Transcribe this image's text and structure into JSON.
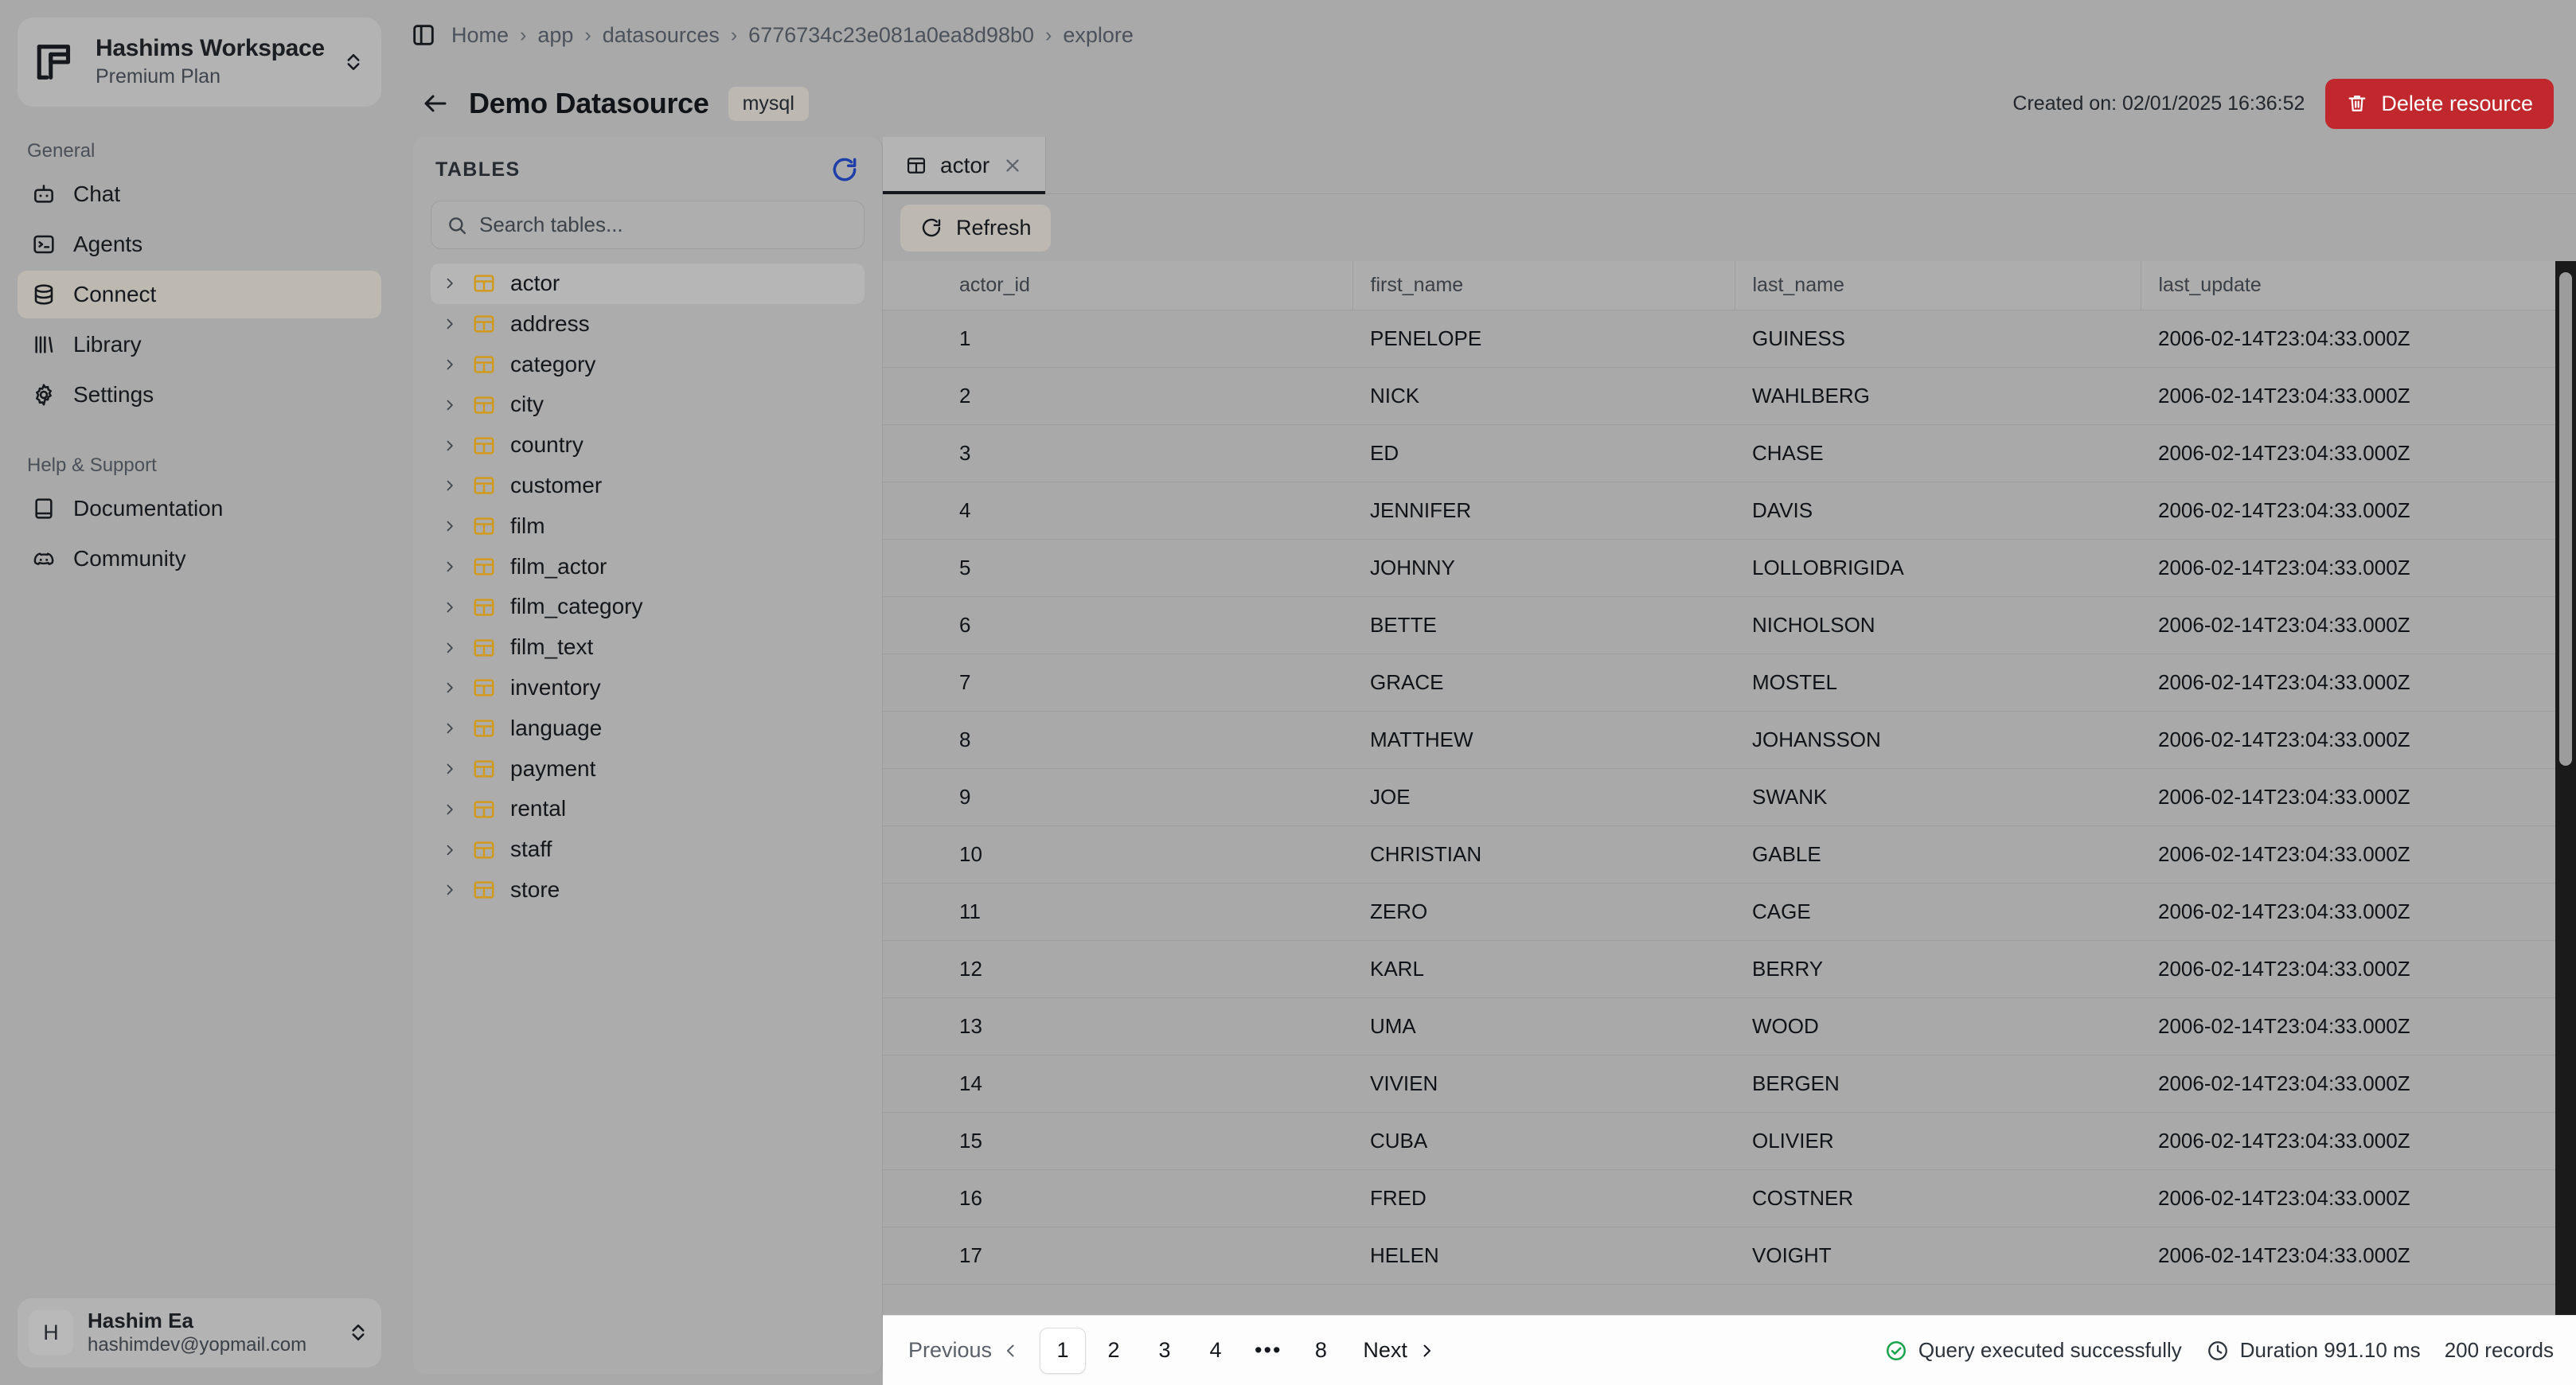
{
  "sidebar": {
    "workspace": {
      "name": "Hashims Workspace",
      "plan": "Premium Plan"
    },
    "sections": [
      {
        "title": "General",
        "items": [
          {
            "label": "Chat",
            "icon": "bot-icon"
          },
          {
            "label": "Agents",
            "icon": "terminal-icon"
          },
          {
            "label": "Connect",
            "icon": "database-icon",
            "active": true
          },
          {
            "label": "Library",
            "icon": "library-icon"
          },
          {
            "label": "Settings",
            "icon": "gear-icon"
          }
        ]
      },
      {
        "title": "Help & Support",
        "items": [
          {
            "label": "Documentation",
            "icon": "book-icon"
          },
          {
            "label": "Community",
            "icon": "discord-icon"
          }
        ]
      }
    ],
    "user": {
      "initial": "H",
      "name": "Hashim Ea",
      "email": "hashimdev@yopmail.com"
    }
  },
  "topbar": {
    "panel_toggle_icon": "panel-left-icon",
    "breadcrumbs": [
      "Home",
      "app",
      "datasources",
      "6776734c23e081a0ea8d98b0",
      "explore"
    ],
    "separator": "›"
  },
  "pagehead": {
    "back_icon": "arrow-left-icon",
    "title": "Demo Datasource",
    "engine": "mysql",
    "created_on": "Created on: 02/01/2025 16:36:52",
    "delete_label": "Delete resource",
    "delete_color": "#c0282d"
  },
  "tables_panel": {
    "title": "TABLES",
    "refresh_icon": "refresh-circle-icon",
    "refresh_color": "#1f3fa8",
    "search_placeholder": "Search tables...",
    "icon_color": "#d19a1d",
    "tables": [
      {
        "name": "actor",
        "selected": true
      },
      {
        "name": "address"
      },
      {
        "name": "category"
      },
      {
        "name": "city"
      },
      {
        "name": "country"
      },
      {
        "name": "customer"
      },
      {
        "name": "film"
      },
      {
        "name": "film_actor"
      },
      {
        "name": "film_category"
      },
      {
        "name": "film_text"
      },
      {
        "name": "inventory"
      },
      {
        "name": "language"
      },
      {
        "name": "payment"
      },
      {
        "name": "rental"
      },
      {
        "name": "staff"
      },
      {
        "name": "store"
      }
    ]
  },
  "tabs": [
    {
      "label": "actor",
      "icon": "table-icon",
      "active": true,
      "close_icon": "close-icon"
    }
  ],
  "toolbar": {
    "refresh_label": "Refresh",
    "refresh_icon": "refresh-icon"
  },
  "grid": {
    "columns": [
      "actor_id",
      "first_name",
      "last_name",
      "last_update"
    ],
    "rows": [
      [
        "1",
        "PENELOPE",
        "GUINESS",
        "2006-02-14T23:04:33.000Z"
      ],
      [
        "2",
        "NICK",
        "WAHLBERG",
        "2006-02-14T23:04:33.000Z"
      ],
      [
        "3",
        "ED",
        "CHASE",
        "2006-02-14T23:04:33.000Z"
      ],
      [
        "4",
        "JENNIFER",
        "DAVIS",
        "2006-02-14T23:04:33.000Z"
      ],
      [
        "5",
        "JOHNNY",
        "LOLLOBRIGIDA",
        "2006-02-14T23:04:33.000Z"
      ],
      [
        "6",
        "BETTE",
        "NICHOLSON",
        "2006-02-14T23:04:33.000Z"
      ],
      [
        "7",
        "GRACE",
        "MOSTEL",
        "2006-02-14T23:04:33.000Z"
      ],
      [
        "8",
        "MATTHEW",
        "JOHANSSON",
        "2006-02-14T23:04:33.000Z"
      ],
      [
        "9",
        "JOE",
        "SWANK",
        "2006-02-14T23:04:33.000Z"
      ],
      [
        "10",
        "CHRISTIAN",
        "GABLE",
        "2006-02-14T23:04:33.000Z"
      ],
      [
        "11",
        "ZERO",
        "CAGE",
        "2006-02-14T23:04:33.000Z"
      ],
      [
        "12",
        "KARL",
        "BERRY",
        "2006-02-14T23:04:33.000Z"
      ],
      [
        "13",
        "UMA",
        "WOOD",
        "2006-02-14T23:04:33.000Z"
      ],
      [
        "14",
        "VIVIEN",
        "BERGEN",
        "2006-02-14T23:04:33.000Z"
      ],
      [
        "15",
        "CUBA",
        "OLIVIER",
        "2006-02-14T23:04:33.000Z"
      ],
      [
        "16",
        "FRED",
        "COSTNER",
        "2006-02-14T23:04:33.000Z"
      ],
      [
        "17",
        "HELEN",
        "VOIGHT",
        "2006-02-14T23:04:33.000Z"
      ]
    ]
  },
  "footer": {
    "previous_label": "Previous",
    "next_label": "Next",
    "pages": [
      "1",
      "2",
      "3",
      "4"
    ],
    "ellipsis": "•••",
    "last_page": "8",
    "current_page": "1",
    "status_text": "Query executed successfully",
    "status_color": "#16a34a",
    "duration_text": "Duration 991.10 ms",
    "records_text": "200 records"
  }
}
